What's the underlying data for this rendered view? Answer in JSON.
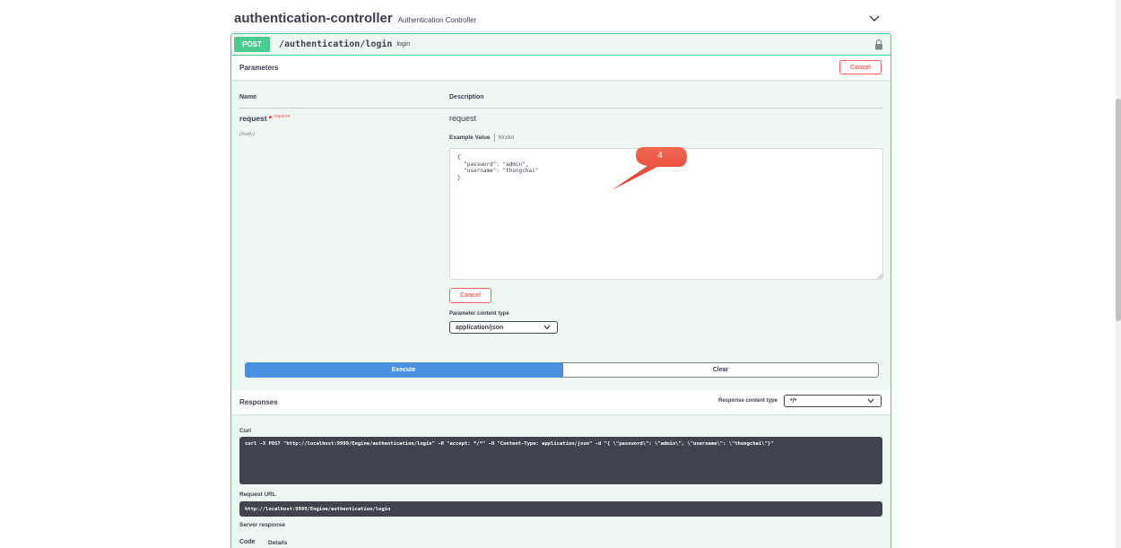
{
  "controller": {
    "name": "authentication-controller",
    "description": "Authentication Controller"
  },
  "operation": {
    "method": "POST",
    "path": "/authentication/login",
    "summary": "login"
  },
  "parameters": {
    "title": "Parameters",
    "cancel_label": "Cancel",
    "col_name": "Name",
    "col_description": "Description",
    "param_name": "request",
    "required_star": "*",
    "required_label": "required",
    "param_in": "(body)",
    "param_description": "request",
    "example_tab": "Example Value",
    "model_tab": "Model",
    "body_value": "{\n  \"password\": \"admin\",\n  \"username\": \"thongchai\"\n}",
    "cancel_label_2": "Cancel",
    "content_type_label": "Parameter content type",
    "content_type_value": "application/json",
    "execute_label": "Execute",
    "clear_label": "Clear"
  },
  "responses": {
    "title": "Responses",
    "content_type_label": "Response content type",
    "content_type_value": "*/*",
    "curl_label": "Curl",
    "curl_value": "curl -X POST \"http://localhost:9999/Engine/authentication/login\" -H \"accept: */*\" -H \"Content-Type: application/json\" -d \"{ \\\"password\\\": \\\"admin\\\", \\\"username\\\": \\\"thongchai\\\"}\"",
    "request_url_label": "Request URL",
    "request_url_value": "http://localhost:9999/Engine/authentication/login",
    "server_response_label": "Server response",
    "code_header": "Code",
    "details_header": "Details"
  },
  "annotation": {
    "number": "4",
    "color": "#e8453c"
  },
  "colors": {
    "post": "#49cc90",
    "execute": "#4990e2",
    "cancel": "#ff6060",
    "dark_box": "#41444e"
  },
  "icons": [
    "chevron-down-icon",
    "lock-icon",
    "resize-grip-icon",
    "callout-arrow-icon"
  ]
}
